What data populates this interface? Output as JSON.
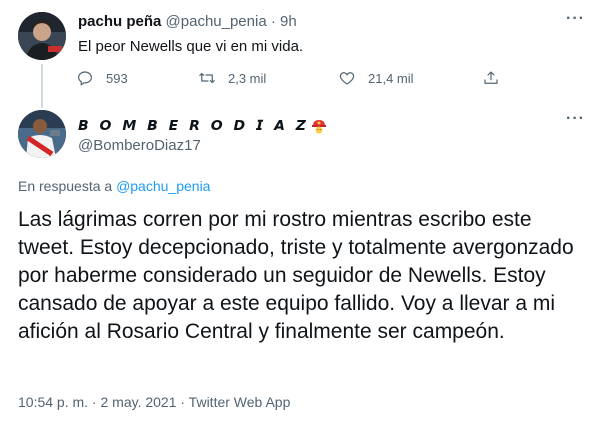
{
  "parent_tweet": {
    "display_name": "pachu peña",
    "handle": "@pachu_penia",
    "separator": "·",
    "age": "9h",
    "text": "El peor Newells que vi en mi vida.",
    "replies": "593",
    "retweets": "2,3 mil",
    "likes": "21,4 mil",
    "more_icon": "more-dots-icon"
  },
  "reply_tweet": {
    "display_name": "𝘽 𝙊 𝙈 𝘽 𝙀 𝙍 𝙊 𝘿 𝙄 𝘼 𝙕",
    "display_name_plain": "BOMBERODIAZ",
    "emoji": "firefighter-emoji",
    "handle": "@BomberoDiaz17",
    "reply_to_prefix": "En respuesta a ",
    "reply_to_handle": "@pachu_penia",
    "text": "Las lágrimas corren por mi rostro mientras escribo este tweet. Estoy decepcionado, triste y totalmente avergonzado por haberme considerado un seguidor de Newells. Estoy cansado de apoyar a este equipo fallido. Voy a llevar a mi afición al Rosario Central y finalmente ser campeón.",
    "timestamp": "10:54 p. m. · 2 may. 2021 · Twitter Web App"
  },
  "colors": {
    "text": "#0f1419",
    "secondary": "#536471",
    "link": "#1d9bf0",
    "thread_line": "#cfd9de"
  }
}
